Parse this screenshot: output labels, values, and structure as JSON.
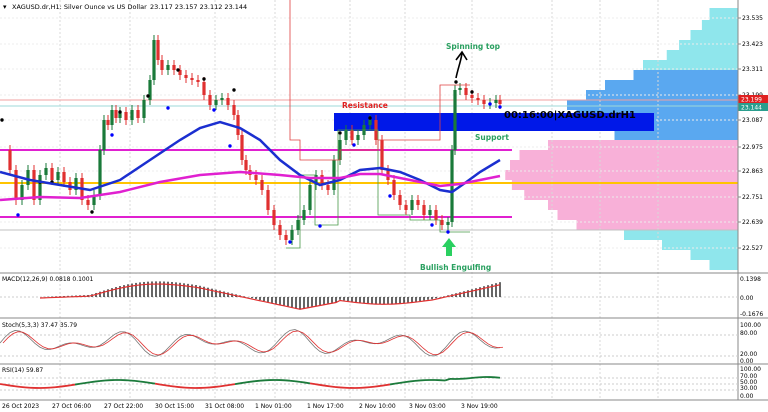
{
  "window": {
    "title": "XAGUSD.dr,H1: Silver Ounce vs US Dollar",
    "ohlc": "23.117 23.157 23.112 23.144"
  },
  "overlay": {
    "time_label": "00:16:00|XAGUSD.drH1"
  },
  "annotations": {
    "spinning_top": "Spinning top",
    "resistance": "Resistance",
    "support": "Support",
    "bullish_engulfing": "Bullish Engulfing"
  },
  "price_axis": {
    "labels": [
      "23.535",
      "23.423",
      "23.311",
      "23.199",
      "23.087",
      "22.975",
      "22.863",
      "22.751",
      "22.639",
      "22.527"
    ],
    "current_price": "23.144",
    "current_price_marker": "23.199"
  },
  "time_axis": {
    "labels": [
      "26 Oct 2023",
      "27 Oct 06:00",
      "27 Oct 22:00",
      "30 Oct 15:00",
      "31 Oct 08:00",
      "1 Nov 01:00",
      "1 Nov 17:00",
      "2 Nov 10:00",
      "3 Nov 03:00",
      "3 Nov 19:00"
    ]
  },
  "macd": {
    "label": "MACD(12,26,9) 0.0818 0.1001",
    "axis": [
      "0.1398",
      "0.00",
      "-0.1676"
    ]
  },
  "stoch": {
    "label": "Stoch(5,3,3) 37.47 35.79",
    "axis": [
      "100.00",
      "80.00",
      "20.00",
      "0.00"
    ]
  },
  "rsi": {
    "label": "RSI(14) 59.87",
    "axis": [
      "100.00",
      "70.00",
      "50.00",
      "30.00",
      "0.00"
    ]
  },
  "colors": {
    "bull": "#1a7a3a",
    "bear": "#e03030",
    "ma_blue": "#1b2fd0",
    "ma_magenta": "#e020d0",
    "pivot_yellow": "#ffc400",
    "zone_blue": "#0018e8",
    "volume_blue": "#5aa8f0",
    "volume_pink": "#f8b0d8",
    "volume_cyan": "#8fe6ec",
    "annotation_green": "#2aa060"
  }
}
